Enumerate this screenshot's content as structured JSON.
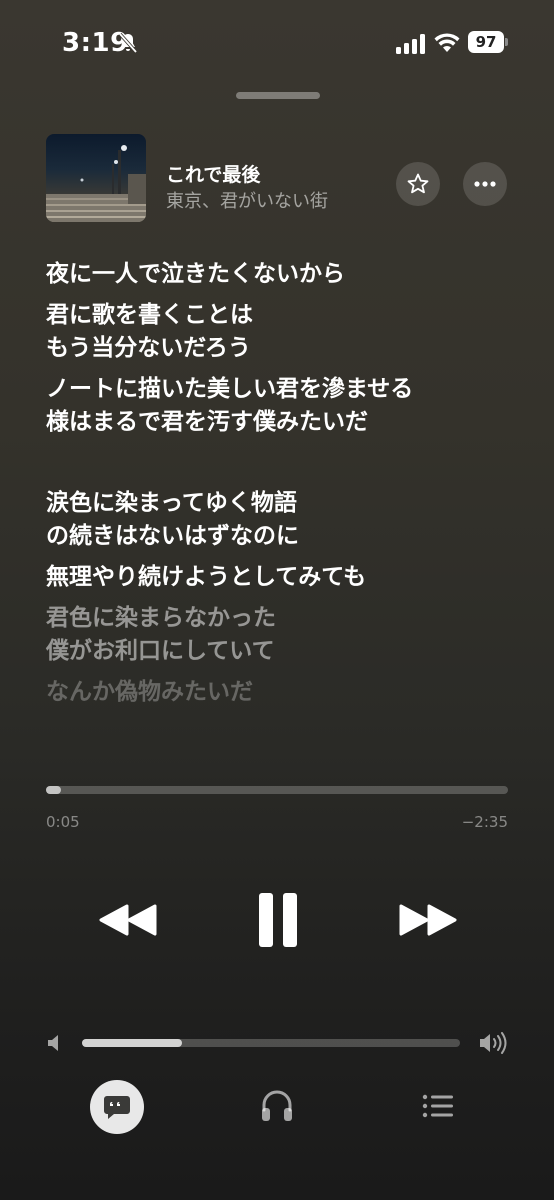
{
  "status_bar": {
    "time": "3:19",
    "battery": "97",
    "icons": [
      "bell-slash-icon",
      "cellular-signal-icon",
      "wifi-icon",
      "battery-icon"
    ]
  },
  "now_playing": {
    "title": "これで最後",
    "subtitle": "東京、君がいない街",
    "buttons": [
      "star-icon",
      "more-icon"
    ]
  },
  "lyrics": [
    {
      "lines": [
        "夜に一人で泣きたくないから"
      ],
      "opacity": 1.0
    },
    {
      "lines": [
        "君に歌を書くことは",
        "もう当分ないだろう"
      ],
      "opacity": 1.0
    },
    {
      "lines": [
        "ノートに描いた美しい君を滲ませる",
        "様はまるで君を汚す僕みたいだ"
      ],
      "opacity": 1.0
    },
    {
      "lines": [
        "涙色に染まってゆく物語",
        "の続きはないはずなのに"
      ],
      "opacity": 1.0
    },
    {
      "lines": [
        "無理やり続けようとしてみても"
      ],
      "opacity": 1.0
    },
    {
      "lines": [
        "君色に染まらなかった",
        "僕がお利口にしていて"
      ],
      "opacity": 0.5
    },
    {
      "lines": [
        "なんか偽物みたいだ"
      ],
      "opacity": 0.28
    }
  ],
  "playback": {
    "elapsed": "0:05",
    "remaining": "−2:35",
    "progress_fraction": 0.033
  },
  "volume": {
    "level_fraction": 0.265
  },
  "controls": [
    "rewind-icon",
    "pause-icon",
    "fast-forward-icon"
  ],
  "bottom_bar": [
    "lyrics-icon",
    "airplay-headphones-icon",
    "queue-list-icon"
  ]
}
